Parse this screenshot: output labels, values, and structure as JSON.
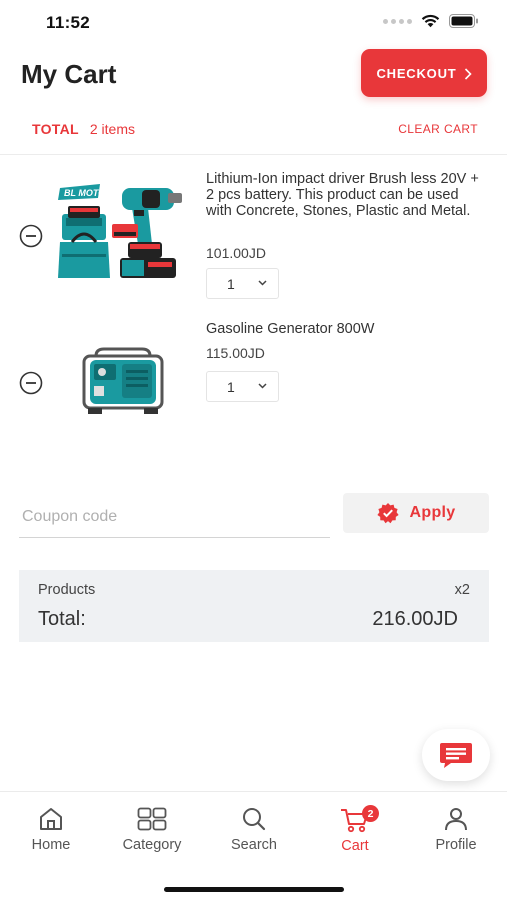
{
  "status_bar": {
    "time": "11:52"
  },
  "header": {
    "title": "My Cart",
    "checkout_label": "CHECKOUT"
  },
  "summary_bar": {
    "total_label": "TOTAL",
    "item_count": "2 items",
    "clear_label": "CLEAR CART"
  },
  "cart_items": [
    {
      "name": "Lithium-Ion impact driver Brush less 20V + 2 pcs battery.  This product can be used with Concrete, Stones, Plastic and Metal.",
      "price": "101.00JD",
      "quantity": "1",
      "image_icon": "impact-driver-kit-image",
      "badge_text": "BL MOTOR"
    },
    {
      "name": "Gasoline Generator 800W",
      "price": "115.00JD",
      "quantity": "1",
      "image_icon": "gasoline-generator-image"
    }
  ],
  "coupon": {
    "placeholder": "Coupon code",
    "apply_label": "Apply"
  },
  "order_summary": {
    "products_label": "Products",
    "products_count": "x2",
    "total_label": "Total:",
    "total_value": "216.00JD"
  },
  "tabs": [
    {
      "label": "Home",
      "icon": "home-icon",
      "active": false
    },
    {
      "label": "Category",
      "icon": "grid-icon",
      "active": false
    },
    {
      "label": "Search",
      "icon": "search-icon",
      "active": false
    },
    {
      "label": "Cart",
      "icon": "cart-icon",
      "active": true,
      "badge": "2"
    },
    {
      "label": "Profile",
      "icon": "profile-icon",
      "active": false
    }
  ],
  "colors": {
    "accent": "#e8373a",
    "teal": "#1a9aa0",
    "summary_bg": "#eff1f3"
  }
}
